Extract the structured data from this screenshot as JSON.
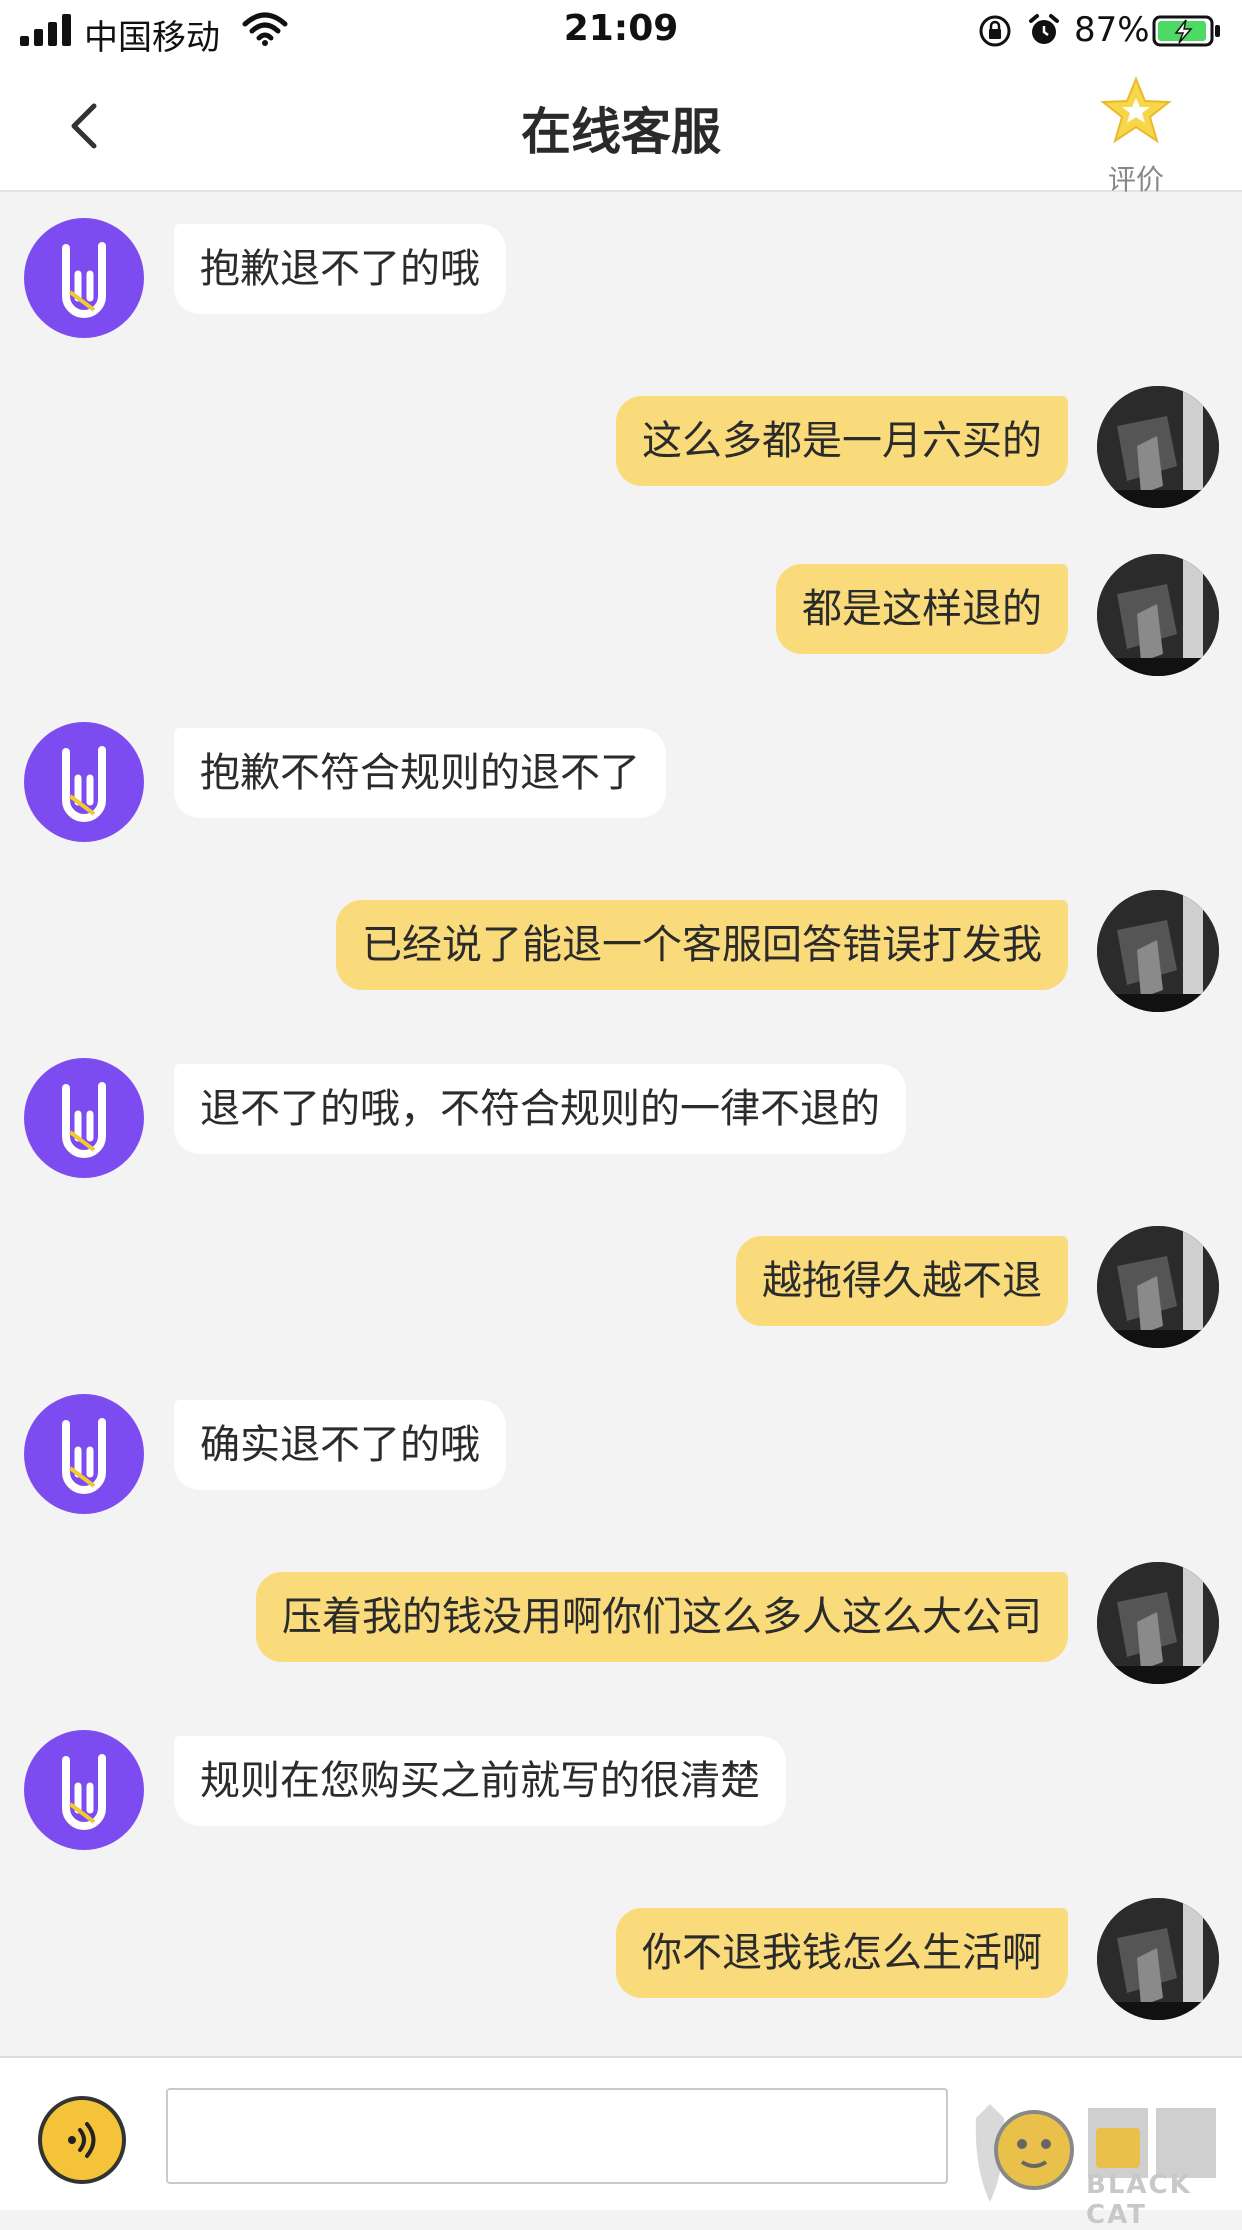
{
  "status_bar": {
    "carrier": "中国移动",
    "time": "21:09",
    "battery_percent": "87%",
    "icons": [
      "signal-icon",
      "wifi-icon",
      "rotation-lock-icon",
      "alarm-icon",
      "battery-charging-icon"
    ]
  },
  "nav": {
    "title": "在线客服",
    "rate_label": "评价",
    "back_icon": "chevron-left-icon",
    "rate_icon": "star-icon"
  },
  "messages": [
    {
      "sender": "bot",
      "text": "抱歉退不了的哦"
    },
    {
      "sender": "user",
      "text": "这么多都是一月六买的"
    },
    {
      "sender": "user",
      "text": "都是这样退的"
    },
    {
      "sender": "bot",
      "text": "抱歉不符合规则的退不了"
    },
    {
      "sender": "user",
      "text": "已经说了能退一个客服回答错误打发我"
    },
    {
      "sender": "bot",
      "text": "退不了的哦，不符合规则的一律不退的"
    },
    {
      "sender": "user",
      "text": "越拖得久越不退"
    },
    {
      "sender": "bot",
      "text": "确实退不了的哦"
    },
    {
      "sender": "user",
      "text": "压着我的钱没用啊你们这么多人这么大公司"
    },
    {
      "sender": "bot",
      "text": "规则在您购买之前就写的很清楚"
    },
    {
      "sender": "user",
      "text": "你不退我钱怎么生活啊"
    }
  ],
  "input_bar": {
    "value": "",
    "voice_icon": "voice-icon"
  },
  "watermark": {
    "text": "BLACK CAT",
    "brand": "黑猫"
  },
  "colors": {
    "bot_avatar": "#7d4cf0",
    "user_bubble": "#f9db7b",
    "bot_bubble": "#ffffff",
    "background": "#f3f3f4",
    "star": "#f4c833"
  }
}
